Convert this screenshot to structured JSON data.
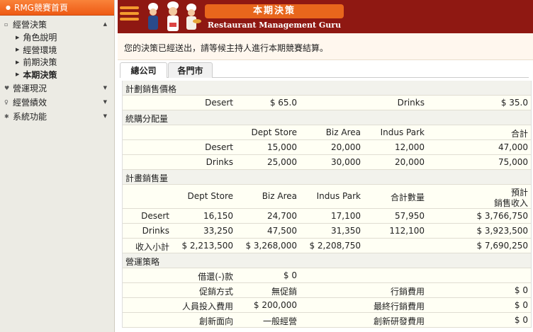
{
  "sidebar": {
    "home": "RMG競賽首頁",
    "sections": [
      {
        "label": "經營決策",
        "expanded": true,
        "items": [
          "角色說明",
          "經營環境",
          "前期決策",
          "本期決策"
        ],
        "active_item": "本期決策"
      },
      {
        "label": "營運現況",
        "expanded": false
      },
      {
        "label": "經營績效",
        "expanded": false
      },
      {
        "label": "系統功能",
        "expanded": false
      }
    ]
  },
  "header": {
    "title": "本期決策",
    "subtitle": "Restaurant Management Guru"
  },
  "notice": "您的決策已經送出，請等候主持人進行本期競賽結算。",
  "tabs": [
    "總公司",
    "各門市"
  ],
  "active_tab": "總公司",
  "planned_price": {
    "title": "計劃銷售價格",
    "desert_label": "Desert",
    "desert_value": "$ 65.0",
    "drinks_label": "Drinks",
    "drinks_value": "$ 35.0"
  },
  "purchase_allocation": {
    "title": "統購分配量",
    "headers": [
      "Dept Store",
      "Biz Area",
      "Indus Park",
      "合計"
    ],
    "rows": [
      {
        "label": "Desert",
        "values": [
          "15,000",
          "20,000",
          "12,000",
          "47,000"
        ]
      },
      {
        "label": "Drinks",
        "values": [
          "25,000",
          "30,000",
          "20,000",
          "75,000"
        ]
      }
    ]
  },
  "planned_sales": {
    "title": "計畫銷售量",
    "headers": [
      "Dept Store",
      "Biz Area",
      "Indus Park",
      "合計數量",
      "預計",
      "銷售收入"
    ],
    "rows": [
      {
        "label": "Desert",
        "values": [
          "16,150",
          "24,700",
          "17,100",
          "57,950",
          "$ 3,766,750"
        ]
      },
      {
        "label": "Drinks",
        "values": [
          "33,250",
          "47,500",
          "31,350",
          "112,100",
          "$ 3,923,500"
        ]
      },
      {
        "label": "收入小計",
        "values": [
          "$ 2,213,500",
          "$ 3,268,000",
          "$ 2,208,750",
          "",
          "$ 7,690,250"
        ]
      }
    ]
  },
  "strategy": {
    "title": "營運策略",
    "rows": [
      {
        "label": "借還(-)款",
        "value": "$ 0",
        "label2": "",
        "value2": ""
      },
      {
        "label": "促銷方式",
        "value": "無促銷",
        "label2": "行銷費用",
        "value2": "$ 0"
      },
      {
        "label": "人員投入費用",
        "value": "$ 200,000",
        "label2": "最終行銷費用",
        "value2": "$ 0"
      },
      {
        "label": "創新面向",
        "value": "一般經營",
        "label2": "創新研發費用",
        "value2": "$ 0"
      }
    ]
  }
}
